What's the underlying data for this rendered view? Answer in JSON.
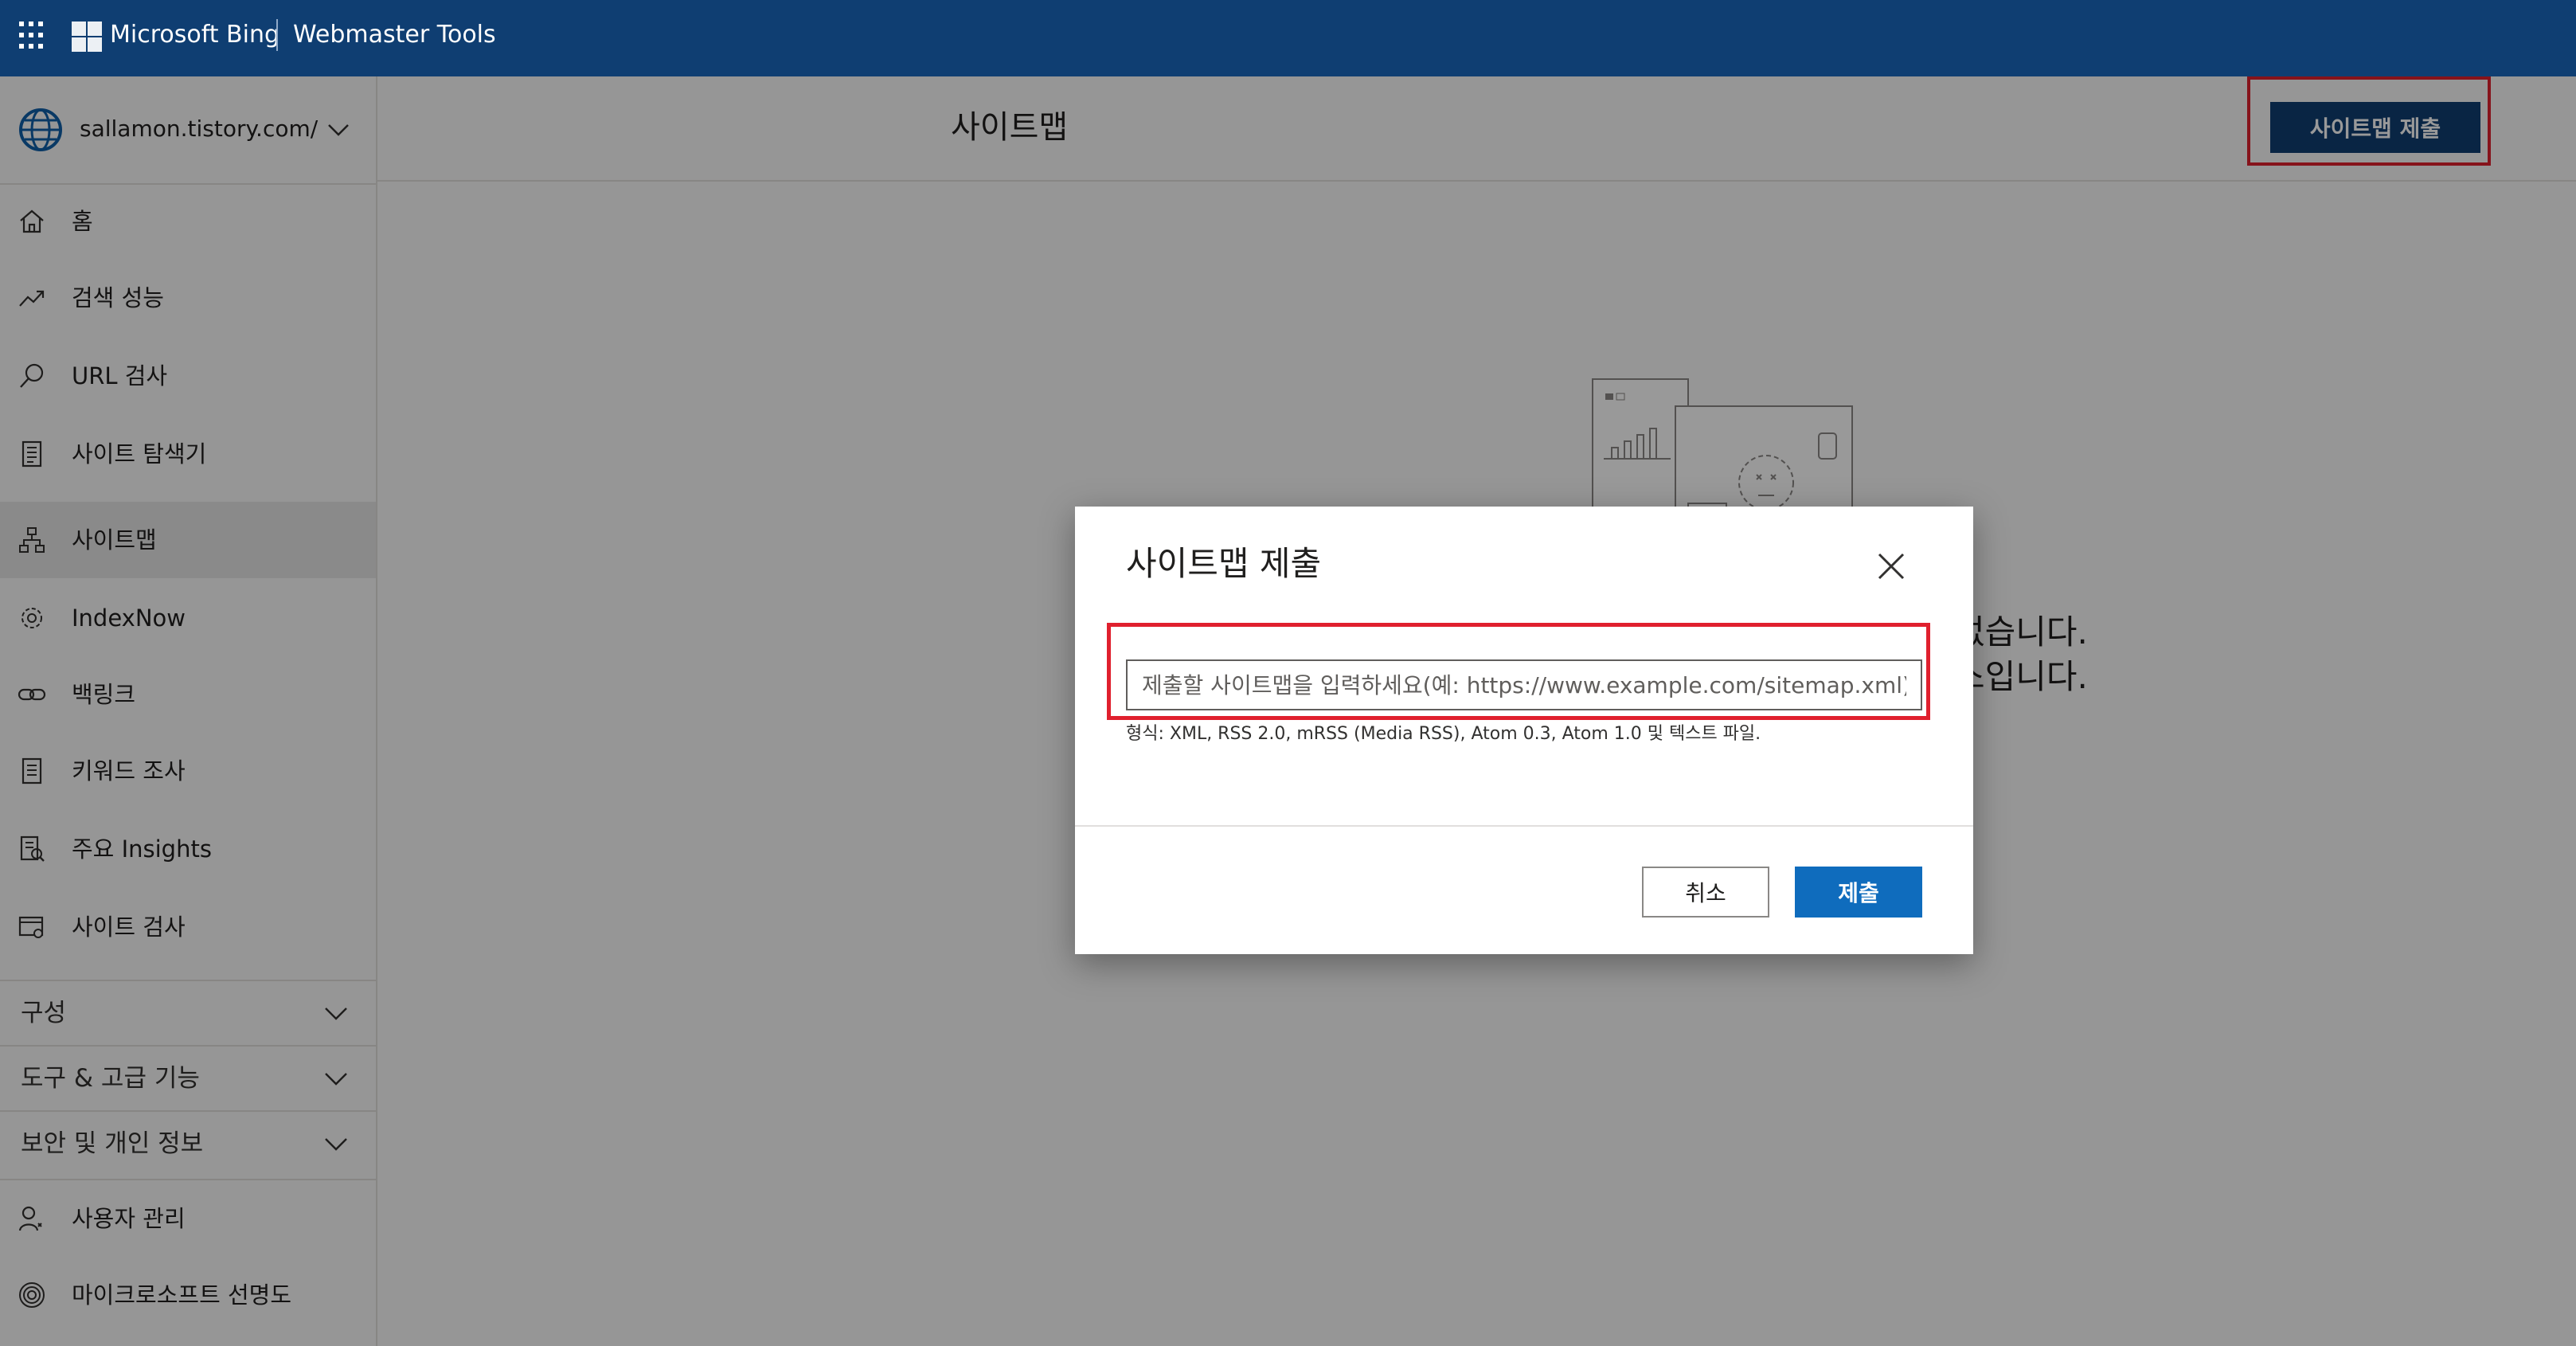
{
  "header": {
    "brand": "Microsoft Bing",
    "product": "Webmaster Tools",
    "icons": [
      "app-launcher-icon",
      "microsoft-logo-icon"
    ]
  },
  "sidebar": {
    "site": "sallamon.tistory.com/",
    "items": [
      {
        "label": "홈",
        "icon": "home-icon"
      },
      {
        "label": "검색 성능",
        "icon": "trend-icon"
      },
      {
        "label": "URL 검사",
        "icon": "search-icon"
      },
      {
        "label": "사이트 탐색기",
        "icon": "document-list-icon"
      },
      {
        "label": "사이트맵",
        "icon": "sitemap-icon",
        "active": true
      },
      {
        "label": "IndexNow",
        "icon": "gear-icon"
      },
      {
        "label": "백링크",
        "icon": "link-icon"
      },
      {
        "label": "키워드 조사",
        "icon": "document-icon"
      },
      {
        "label": "주요 Insights",
        "icon": "insights-icon"
      },
      {
        "label": "사이트 검사",
        "icon": "site-scan-icon"
      }
    ],
    "sections": [
      {
        "label": "구성"
      },
      {
        "label": "도구 & 고급 기능"
      },
      {
        "label": "보안 및 개인 정보"
      }
    ],
    "bottom_items": [
      {
        "label": "사용자 관리",
        "icon": "user-icon"
      },
      {
        "label": "마이크로소프트 선명도",
        "icon": "fingerprint-icon"
      }
    ]
  },
  "main": {
    "title": "사이트맵",
    "submit_button": "사이트맵 제출",
    "empty_line1": "없습니다.",
    "empty_line2": "스입니다."
  },
  "dialog": {
    "title": "사이트맵 제출",
    "input_value": "",
    "input_placeholder": "제출할 사이트맵을 입력하세요(예: https://www.example.com/sitemap.xml).",
    "hint": "형식: XML, RSS 2.0, mRSS (Media RSS), Atom 0.3, Atom 1.0 및 텍스트 파일.",
    "cancel": "취소",
    "submit": "제출"
  },
  "colors": {
    "header_bg": "#0f3e72",
    "primary_button": "#0f6cbd",
    "highlight": "#e0202e"
  }
}
